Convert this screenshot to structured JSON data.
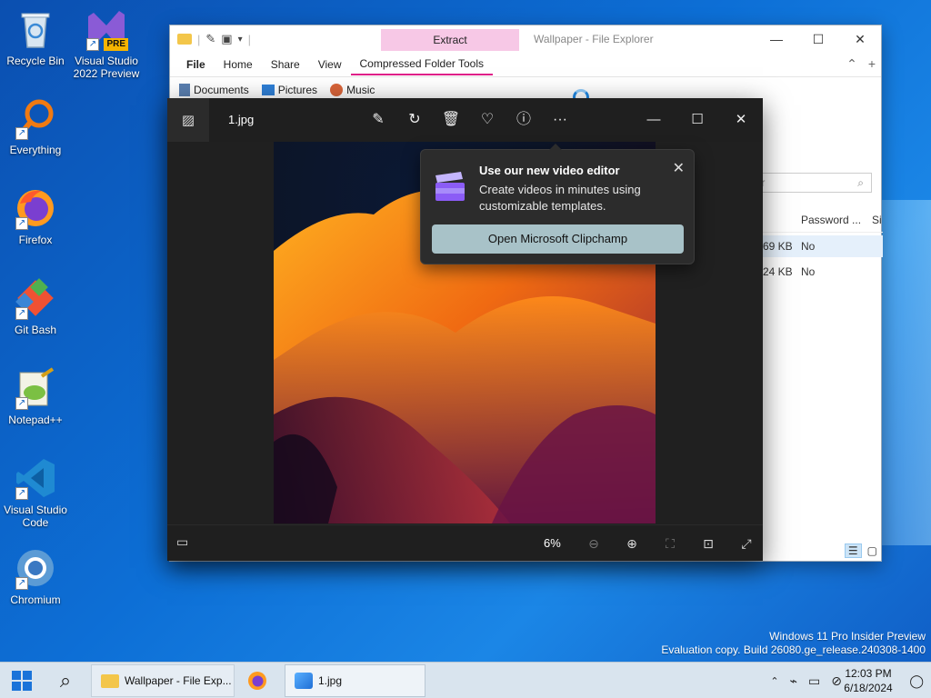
{
  "desktop": {
    "icons": [
      {
        "label": "Recycle Bin",
        "icon": "recycle-bin-icon"
      },
      {
        "label": "Visual Studio 2022 Preview",
        "icon": "visual-studio-preview-icon",
        "badge": "PRE"
      },
      {
        "label": "Everything",
        "icon": "everything-search-icon"
      },
      {
        "label": "Firefox",
        "icon": "firefox-icon"
      },
      {
        "label": "Git Bash",
        "icon": "git-bash-icon"
      },
      {
        "label": "Notepad++",
        "icon": "notepad-plus-plus-icon"
      },
      {
        "label": "Visual Studio Code",
        "icon": "vscode-icon"
      },
      {
        "label": "Chromium",
        "icon": "chromium-icon"
      }
    ],
    "watermark": {
      "line1": "Windows 11 Pro Insider Preview",
      "line2": "Evaluation copy. Build 26080.ge_release.240308-1400"
    }
  },
  "explorer": {
    "extract_label": "Extract",
    "window_title": "Wallpaper - File Explorer",
    "ribbon_tabs": [
      "File",
      "Home",
      "Share",
      "View",
      "Compressed Folder Tools"
    ],
    "quick_links": [
      "Documents",
      "Pictures",
      "Music"
    ],
    "search_placeholder": "per",
    "columns": {
      "password": "Password ...",
      "si": "Si"
    },
    "rows": [
      {
        "size": "69 KB",
        "password": "No"
      },
      {
        "size": "24 KB",
        "password": "No"
      }
    ]
  },
  "photos": {
    "filename": "1.jpg",
    "toolbar": [
      "edit-image",
      "rotate",
      "delete",
      "favorite",
      "info",
      "more"
    ],
    "zoom": "6%",
    "popup": {
      "title": "Use our new video editor",
      "body": "Create videos in minutes using customizable templates.",
      "button": "Open Microsoft Clipchamp"
    }
  },
  "taskbar": {
    "apps": [
      {
        "label": "Wallpaper - File Exp...",
        "icon": "folder-icon"
      },
      {
        "label": "",
        "icon": "firefox-icon"
      },
      {
        "label": "1.jpg",
        "icon": "photos-icon"
      }
    ],
    "time": "12:03 PM",
    "date": "6/18/2024"
  },
  "colors": {
    "desktop_blue": "#0d6fd6",
    "photos_bg": "#202020",
    "popup_button": "#a8c2c8",
    "extract_tab": "#f7c8e6",
    "taskbar": "#d9e4ee"
  }
}
